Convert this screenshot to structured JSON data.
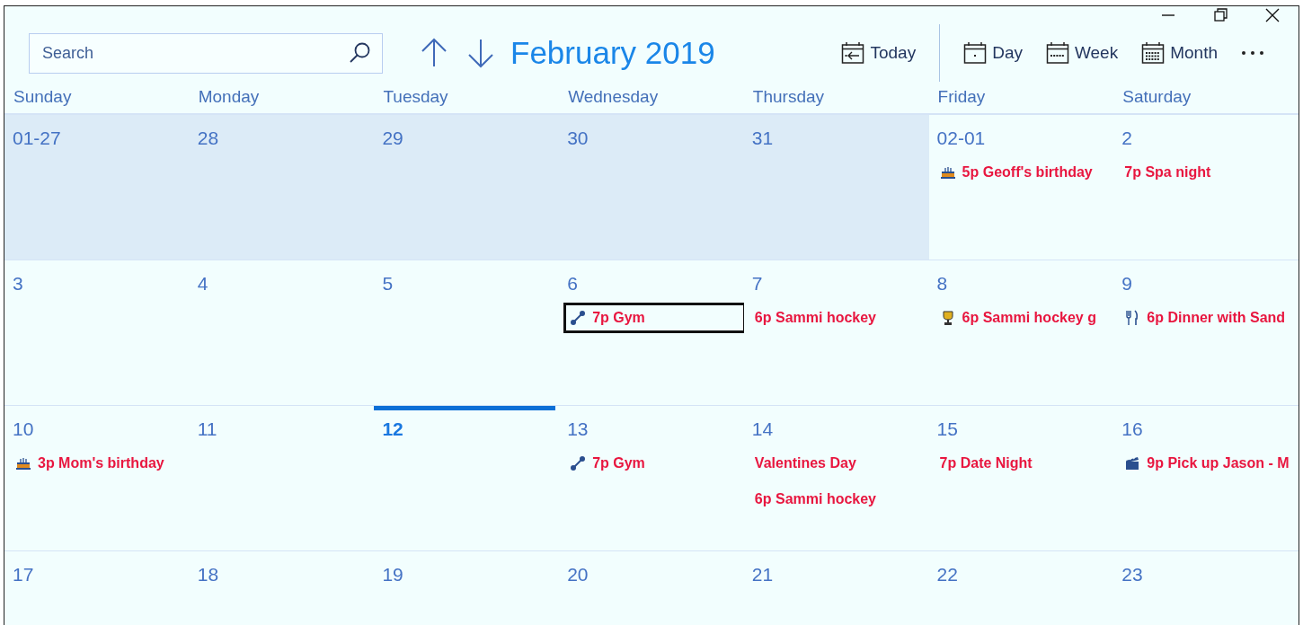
{
  "search": {
    "placeholder": "Search"
  },
  "title": "February 2019",
  "toolbar": [
    {
      "label": "Today",
      "kind": "today"
    },
    {
      "label": "Day",
      "kind": "day"
    },
    {
      "label": "Week",
      "kind": "week"
    },
    {
      "label": "Month",
      "kind": "month"
    }
  ],
  "weekdays": [
    "Sunday",
    "Monday",
    "Tuesday",
    "Wednesday",
    "Thursday",
    "Friday",
    "Saturday"
  ],
  "weeks": [
    [
      {
        "date": "01-27",
        "in_month": false,
        "today": false
      },
      {
        "date": "28",
        "in_month": false,
        "today": false
      },
      {
        "date": "29",
        "in_month": false,
        "today": false
      },
      {
        "date": "30",
        "in_month": false,
        "today": false
      },
      {
        "date": "31",
        "in_month": false,
        "today": false
      },
      {
        "date": "02-01",
        "in_month": true,
        "today": false,
        "events": [
          {
            "text": "5p Geoff's birthday",
            "kind": "birthday",
            "selected": false
          }
        ]
      },
      {
        "date": "2",
        "in_month": true,
        "today": false,
        "events": [
          {
            "text": "7p Spa night",
            "kind": "plain",
            "selected": false
          }
        ]
      }
    ],
    [
      {
        "date": "3",
        "in_month": true,
        "today": false
      },
      {
        "date": "4",
        "in_month": true,
        "today": false
      },
      {
        "date": "5",
        "in_month": true,
        "today": false
      },
      {
        "date": "6",
        "in_month": true,
        "today": false,
        "events": [
          {
            "text": "7p Gym",
            "kind": "gym",
            "selected": true
          }
        ]
      },
      {
        "date": "7",
        "in_month": true,
        "today": false,
        "events": [
          {
            "text": "6p Sammi hockey",
            "kind": "plain",
            "selected": false
          }
        ]
      },
      {
        "date": "8",
        "in_month": true,
        "today": false,
        "events": [
          {
            "text": "6p Sammi hockey g",
            "kind": "trophy",
            "selected": false
          }
        ]
      },
      {
        "date": "9",
        "in_month": true,
        "today": false,
        "events": [
          {
            "text": "6p Dinner with Sand",
            "kind": "dinner",
            "selected": false
          }
        ]
      }
    ],
    [
      {
        "date": "10",
        "in_month": true,
        "today": false,
        "events": [
          {
            "text": "3p Mom's birthday",
            "kind": "birthday",
            "selected": false
          }
        ]
      },
      {
        "date": "11",
        "in_month": true,
        "today": false
      },
      {
        "date": "12",
        "in_month": true,
        "today": true
      },
      {
        "date": "13",
        "in_month": true,
        "today": false,
        "events": [
          {
            "text": "7p Gym",
            "kind": "gym",
            "selected": false
          }
        ]
      },
      {
        "date": "14",
        "in_month": true,
        "today": false,
        "events": [
          {
            "text": "Valentines Day",
            "kind": "plain",
            "selected": false
          },
          {
            "text": "6p Sammi hockey",
            "kind": "plain",
            "selected": false
          }
        ]
      },
      {
        "date": "15",
        "in_month": true,
        "today": false,
        "events": [
          {
            "text": "7p Date Night",
            "kind": "plain",
            "selected": false
          }
        ]
      },
      {
        "date": "16",
        "in_month": true,
        "today": false,
        "events": [
          {
            "text": "9p Pick up Jason - M",
            "kind": "movie",
            "selected": false
          }
        ]
      }
    ],
    [
      {
        "date": "17",
        "in_month": true,
        "today": false
      },
      {
        "date": "18",
        "in_month": true,
        "today": false
      },
      {
        "date": "19",
        "in_month": true,
        "today": false
      },
      {
        "date": "20",
        "in_month": true,
        "today": false
      },
      {
        "date": "21",
        "in_month": true,
        "today": false
      },
      {
        "date": "22",
        "in_month": true,
        "today": false
      },
      {
        "date": "23",
        "in_month": true,
        "today": false
      }
    ]
  ]
}
